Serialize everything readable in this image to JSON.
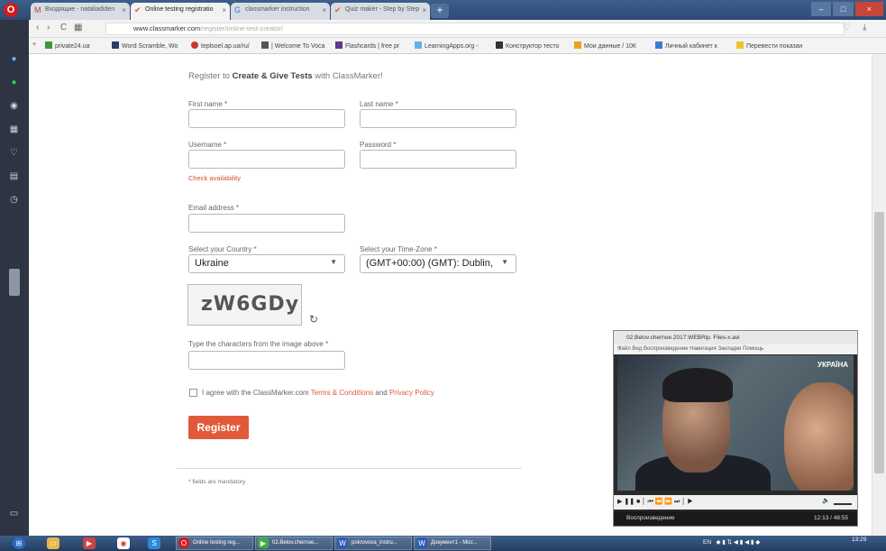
{
  "browser": {
    "tabs": [
      {
        "label": "Входящие - nataliadiden",
        "icon": "gmail-icon"
      },
      {
        "label": "Online testing registratio",
        "icon": "classmarker-icon"
      },
      {
        "label": "classmarker instruction",
        "icon": "google-icon"
      },
      {
        "label": "Quiz maker - Step by Step",
        "icon": "classmarker-icon"
      }
    ],
    "url_domain": "www.classmarker.com",
    "url_path": "/register/online-test-creator/",
    "bookmarks": [
      "private24.ua",
      "Word Scramble, Wo",
      "teplsoel.ap.ua/ru/",
      "| Welcome To Voca",
      "Flashcards | free pr",
      "LearningApps.org -",
      "Конструктор тесто",
      "Мои данные / 10К",
      "Личный кабинет к",
      "Перевести показан"
    ]
  },
  "form": {
    "heading_prefix": "Register to ",
    "heading_bold": "Create & Give Tests",
    "heading_suffix": " with ClassMarker!",
    "first_name_label": "First name *",
    "last_name_label": "Last name *",
    "username_label": "Username *",
    "password_label": "Password *",
    "check_availability": "Check availability",
    "email_label": "Email address *",
    "country_label": "Select your Country *",
    "country_value": "Ukraine",
    "timezone_label": "Select your Time-Zone *",
    "timezone_value": "(GMT+00:00) (GMT): Dublin,",
    "captcha_text": "zW6GDy",
    "captcha_label": "Type the characters from the image above *",
    "agree_prefix": "I agree with the ClassMarker.com ",
    "terms_link": "Terms & Conditions",
    "agree_and": " and ",
    "privacy_link": "Privacy Policy",
    "register_button": "Register",
    "mandatory_note": "* fields are mandatory"
  },
  "player": {
    "title": "02.Belov.chernoe.2017.WEBRip. Files-x.avi",
    "menu": "Файл   Вид   Воспроизведение   Навигация   Закладки   Помощь",
    "channel": "УКРАЇНА",
    "status": "Воспроизведение",
    "time": "12:13 / 48:55"
  },
  "taskbar": {
    "items": [
      "Online testing reg...",
      "02.Belov.chernoe...",
      "pokrovova_instru...",
      "Документ1 - Micr..."
    ],
    "lang": "EN",
    "clock": "13:29"
  },
  "colors": {
    "accent": "#e05a3a",
    "link": "#e05a3a",
    "sidebar": "#2e3441"
  }
}
